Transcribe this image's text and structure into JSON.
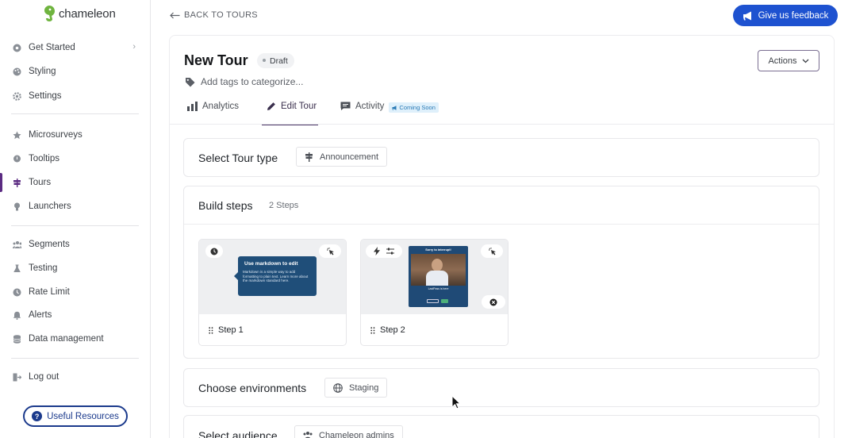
{
  "brand": {
    "name": "chameleon"
  },
  "sidebar": {
    "items": [
      {
        "label": "Get Started",
        "icon": "circle-dot-icon",
        "has_chevron": true
      },
      {
        "label": "Styling",
        "icon": "palette-icon"
      },
      {
        "label": "Settings",
        "icon": "gear-icon"
      },
      {
        "label": "Microsurveys",
        "icon": "star-icon"
      },
      {
        "label": "Tooltips",
        "icon": "tooltip-icon"
      },
      {
        "label": "Tours",
        "icon": "signpost-icon",
        "active": true
      },
      {
        "label": "Launchers",
        "icon": "bulb-icon"
      },
      {
        "label": "Segments",
        "icon": "users-icon"
      },
      {
        "label": "Testing",
        "icon": "flask-icon"
      },
      {
        "label": "Rate Limit",
        "icon": "clock-icon"
      },
      {
        "label": "Alerts",
        "icon": "bell-icon"
      },
      {
        "label": "Data management",
        "icon": "database-icon"
      },
      {
        "label": "Log out",
        "icon": "logout-icon"
      }
    ],
    "resources_label": "Useful Resources"
  },
  "topbar": {
    "back_label": "BACK TO TOURS",
    "feedback_label": "Give us feedback"
  },
  "tour": {
    "title": "New Tour",
    "status": "Draft",
    "actions_label": "Actions",
    "tags_placeholder": "Add tags to categorize..."
  },
  "tabs": [
    {
      "label": "Analytics",
      "icon": "bar-chart-icon"
    },
    {
      "label": "Edit Tour",
      "icon": "pencil-icon",
      "active": true
    },
    {
      "label": "Activity",
      "icon": "chat-icon",
      "badge": "Coming Soon"
    }
  ],
  "sections": {
    "tour_type": {
      "heading": "Select Tour type",
      "value": "Announcement"
    },
    "build_steps": {
      "heading": "Build steps",
      "count": "2 Steps",
      "steps": [
        {
          "label": "Step 1",
          "preview_title": "Use markdown to edit",
          "preview_body": "Markdown is a simple way to add formatting to plain text. Learn more about the markdown standard here."
        },
        {
          "label": "Step 2",
          "preview_title": "Sorry to interrupt!",
          "preview_caption": "LastPass is here"
        }
      ]
    },
    "environments": {
      "heading": "Choose environments",
      "value": "Staging"
    },
    "audience": {
      "heading": "Select audience",
      "value": "Chameleon admins"
    }
  },
  "colors": {
    "accent": "#5b2b82",
    "feedback_bg": "#1e52d0",
    "resources": "#1b3a8c",
    "tooltip_bg": "#1f4e79"
  }
}
